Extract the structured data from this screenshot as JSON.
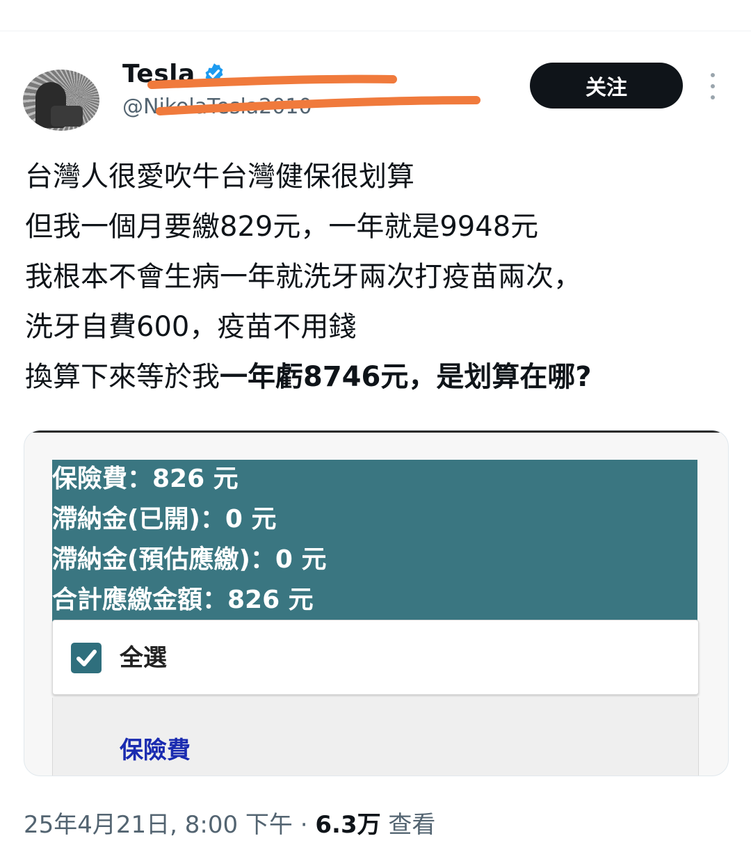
{
  "author": {
    "display_name": "Tesla",
    "handle": "@NikolaTesla2010"
  },
  "follow_label": "关注",
  "tweet_lines": [
    "台灣人很愛吹牛台灣健保很划算",
    "但我一個月要繳829元，一年就是9948元",
    "我根本不會生病一年就洗牙兩次打疫苗兩次，",
    "洗牙自費600，疫苗不用錢"
  ],
  "tweet_last_line": {
    "normal": "換算下來等於我",
    "bold": "一年虧8746元，是划算在哪?"
  },
  "media": {
    "rows": [
      "保險費：826 元",
      "滯納金(已開)：0 元",
      "滯納金(預估應繳)：0 元",
      "合計應繳金額：826 元"
    ],
    "select_all_label": "全選",
    "fee_link_label": "保險費"
  },
  "meta": {
    "timestamp": "25年4月21日, 8:00 下午",
    "separator": " · ",
    "views_count": "6.3万",
    "views_label": " 查看"
  },
  "colors": {
    "accent_blue": "#1d9bf0",
    "teal_panel": "#3a7681",
    "scribble_orange": "#f07a3c"
  }
}
